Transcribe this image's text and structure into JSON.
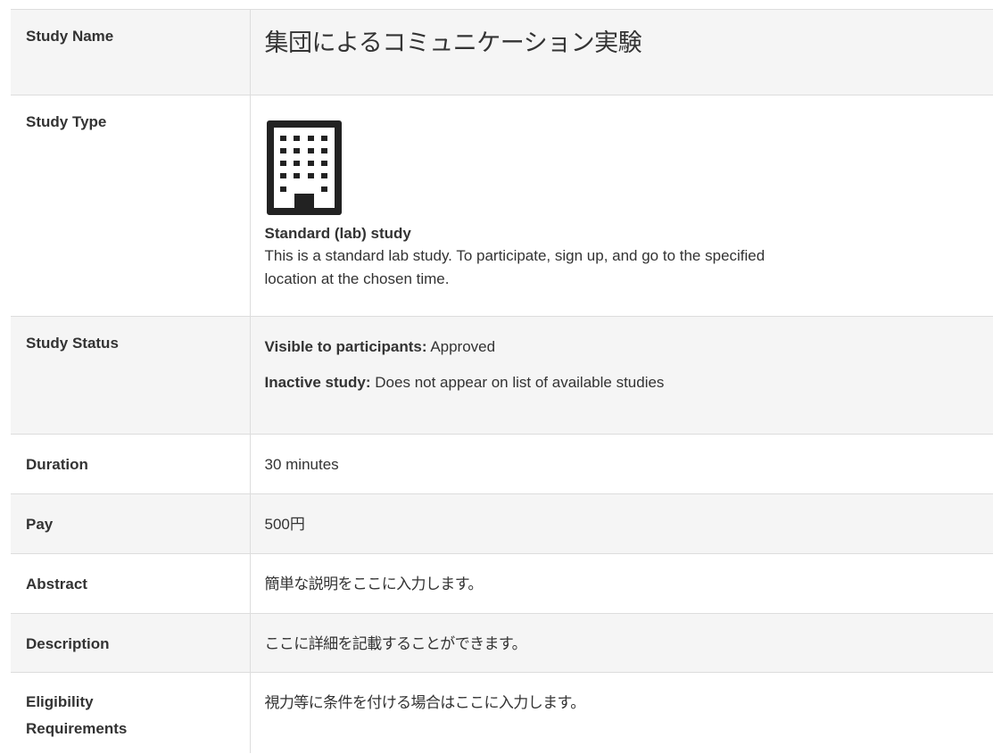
{
  "rows": {
    "name": {
      "label": "Study Name",
      "value": "集団によるコミュニケーション実験"
    },
    "type": {
      "label": "Study Type",
      "icon": "building-icon",
      "title": "Standard (lab) study",
      "desc_line1": "This is a standard lab study. To participate, sign up, and go to the specified",
      "desc_line2": "location at the chosen time."
    },
    "status": {
      "label": "Study Status",
      "visible_label": "Visible to participants:",
      "visible_value": "Approved",
      "inactive_label": "Inactive study:",
      "inactive_value": "Does not appear on list of available studies"
    },
    "duration": {
      "label": "Duration",
      "value": "30 minutes"
    },
    "pay": {
      "label": "Pay",
      "value": "500円"
    },
    "abstract": {
      "label": "Abstract",
      "value": "簡単な説明をここに入力します。"
    },
    "description": {
      "label": "Description",
      "value": "ここに詳細を記載することができます。"
    },
    "eligibility": {
      "label_line1": "Eligibility",
      "label_line2": "Requirements",
      "value": "視力等に条件を付ける場合はここに入力します。"
    }
  }
}
